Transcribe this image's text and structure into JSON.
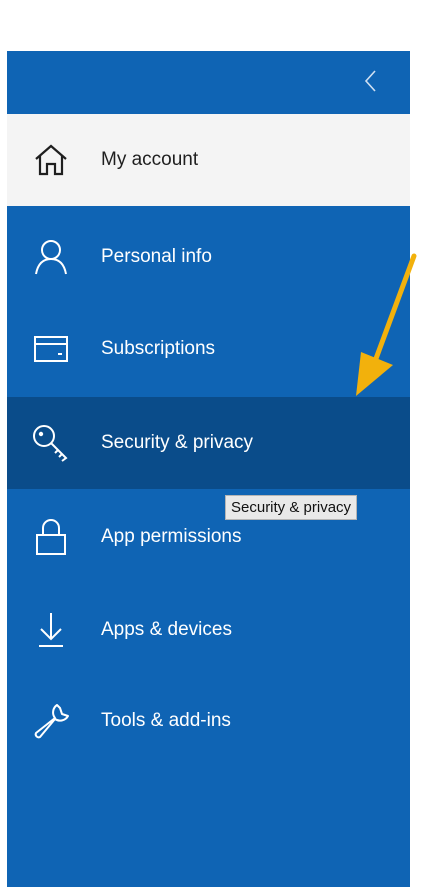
{
  "colors": {
    "sidebar_bg": "#0f64b4",
    "active_item_bg": "#f4f4f4",
    "hover_item_bg": "#0a4c8a",
    "annotation_arrow": "#f2b10c"
  },
  "sidebar": {
    "collapse_icon": "chevron-left-icon",
    "items": [
      {
        "label": "My account",
        "icon": "home-icon"
      },
      {
        "label": "Personal info",
        "icon": "person-icon"
      },
      {
        "label": "Subscriptions",
        "icon": "card-icon"
      },
      {
        "label": "Security & privacy",
        "icon": "key-icon"
      },
      {
        "label": "App permissions",
        "icon": "lock-icon"
      },
      {
        "label": "Apps & devices",
        "icon": "download-icon"
      },
      {
        "label": "Tools & add-ins",
        "icon": "wrench-icon"
      }
    ]
  },
  "tooltip": {
    "text": "Security & privacy"
  }
}
